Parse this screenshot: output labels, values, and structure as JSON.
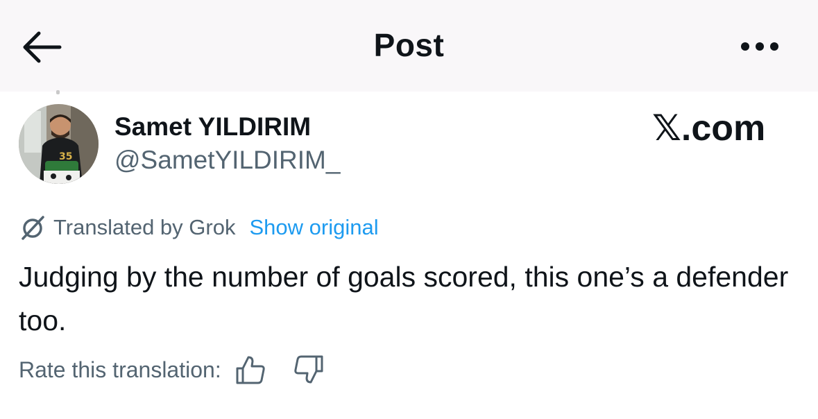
{
  "header": {
    "title": "Post",
    "back_icon": "arrow-left-icon",
    "more_icon": "more-horizontal-icon"
  },
  "author": {
    "name": "Samet YILDIRIM",
    "handle": "@SametYILDIRIM_"
  },
  "watermark": "𝕏.com",
  "translation": {
    "label": "Translated by Grok",
    "show_original": "Show original",
    "icon": "grok-icon"
  },
  "post": {
    "text": "Judging by the number of goals scored, this one’s a defender too."
  },
  "rating": {
    "label": "Rate this translation:",
    "thumbs_up_icon": "thumbs-up-icon",
    "thumbs_down_icon": "thumbs-down-icon"
  },
  "colors": {
    "link": "#1d9bf0",
    "secondary_text": "#536471",
    "primary_text": "#0f1419",
    "header_bg": "#f9f7f9"
  }
}
